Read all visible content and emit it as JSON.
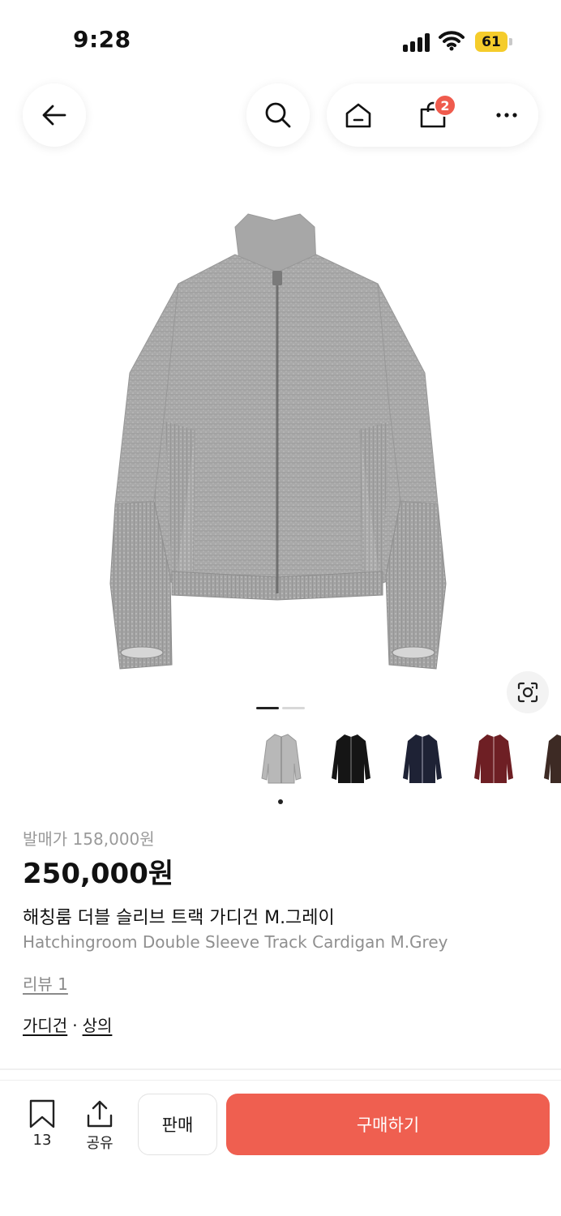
{
  "status_bar": {
    "time": "9:28",
    "battery_level": "61",
    "battery_color": "#f5cc2b"
  },
  "nav": {
    "back_icon": "arrow-left-icon",
    "search_icon": "search-icon",
    "home_icon": "home-icon",
    "cart_icon": "shopping-bag-icon",
    "cart_count": "2",
    "more_icon": "more-horizontal-icon"
  },
  "gallery": {
    "main_image": "grey knit zip-up track cardigan",
    "lens_icon": "image-search-icon",
    "page_count": 2,
    "active_page": 1,
    "thumbnails": [
      {
        "color_name": "grey",
        "color": "#b8b8b8"
      },
      {
        "color_name": "black",
        "color": "#151515"
      },
      {
        "color_name": "navy",
        "color": "#1e2235"
      },
      {
        "color_name": "burgundy",
        "color": "#6e1f24"
      },
      {
        "color_name": "brown",
        "color": "#3d2a24"
      }
    ]
  },
  "product": {
    "release_price": "발매가 158,000원",
    "price": "250,000원",
    "title_ko": "해칭룸 더블 슬리브 트랙 가디건 M.그레이",
    "title_en": "Hatchingroom Double Sleeve Track Cardigan M.Grey",
    "review_link": "리뷰 1",
    "categories": [
      "가디건",
      "상의"
    ],
    "category_separator": "·"
  },
  "bottom_bar": {
    "bookmark_icon": "bookmark-icon",
    "bookmark_count": "13",
    "share_icon": "share-icon",
    "share_label": "공유",
    "sell_label": "판매",
    "buy_label": "구매하기",
    "accent_color": "#ef5f50"
  }
}
